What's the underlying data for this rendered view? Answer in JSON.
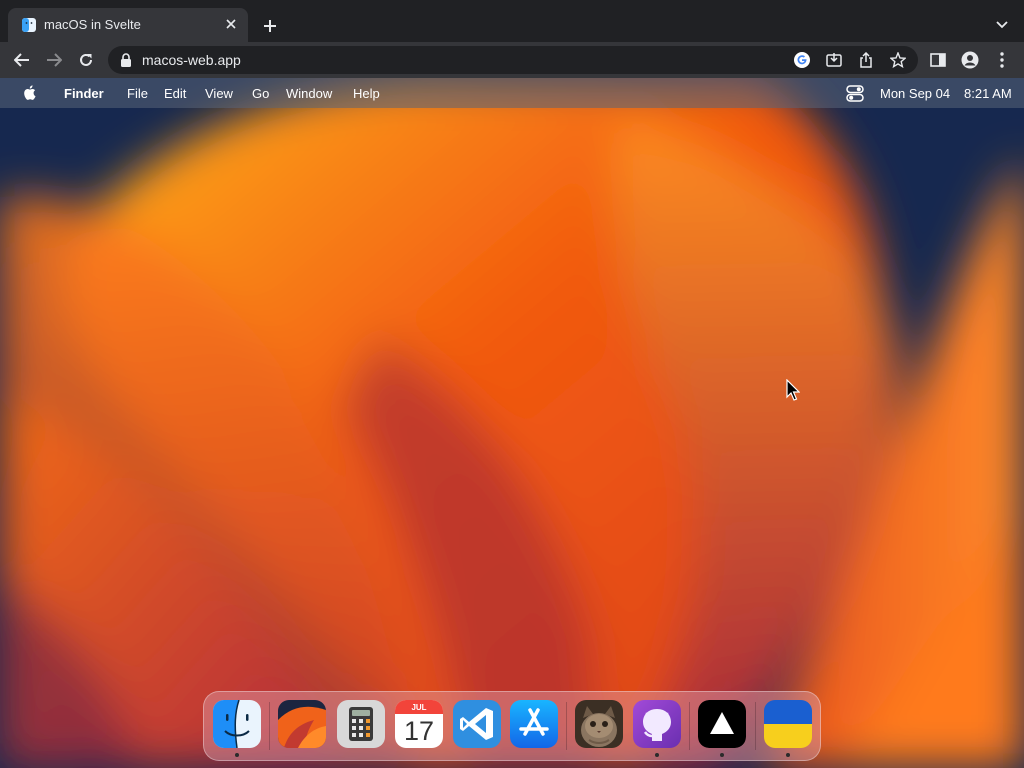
{
  "browser": {
    "tab": {
      "title": "macOS in Svelte",
      "favicon": "finder-favicon-icon",
      "close_icon": "close-icon"
    },
    "new_tab_icon": "plus-icon",
    "tab_search_icon": "chevron-down-icon",
    "toolbar": {
      "back_icon": "back-arrow-icon",
      "forward_icon": "forward-arrow-icon",
      "reload_icon": "reload-icon",
      "url": "macos-web.app",
      "lock_icon": "lock-icon",
      "omnibox_icons": [
        "google-lens-icon",
        "install-app-icon",
        "share-icon",
        "bookmark-star-icon"
      ],
      "right_icons": [
        "side-panel-icon",
        "profile-icon",
        "more-menu-icon"
      ]
    }
  },
  "menubar": {
    "apple_icon": "apple-logo-icon",
    "app_name": "Finder",
    "items": [
      "File",
      "Edit",
      "View",
      "Go",
      "Window",
      "Help"
    ],
    "control_center_icon": "control-center-icon",
    "date": "Mon Sep 04",
    "time": "8:21 AM"
  },
  "dock": {
    "items": [
      {
        "name": "finder",
        "icon": "finder-icon",
        "running": true
      },
      {
        "name": "wallpapers",
        "icon": "wallpapers-icon",
        "running": false
      },
      {
        "name": "calculator",
        "icon": "calculator-icon",
        "running": false
      },
      {
        "name": "calendar",
        "icon": "calendar-icon",
        "running": false,
        "month": "JUL",
        "day": "17"
      },
      {
        "name": "vscode",
        "icon": "vscode-icon",
        "running": false
      },
      {
        "name": "app-store",
        "icon": "app-store-icon",
        "running": false
      },
      {
        "name": "purus-twitter",
        "icon": "cat-photo-icon",
        "running": false
      },
      {
        "name": "github",
        "icon": "github-icon",
        "running": true
      },
      {
        "name": "vercel",
        "icon": "vercel-icon",
        "running": true
      },
      {
        "name": "ukraine",
        "icon": "ukraine-flag-icon",
        "running": true
      }
    ]
  },
  "colors": {
    "wallpaper_orange": "#f25a10",
    "wallpaper_navy": "#16284f",
    "wallpaper_magenta": "#a3264a"
  }
}
